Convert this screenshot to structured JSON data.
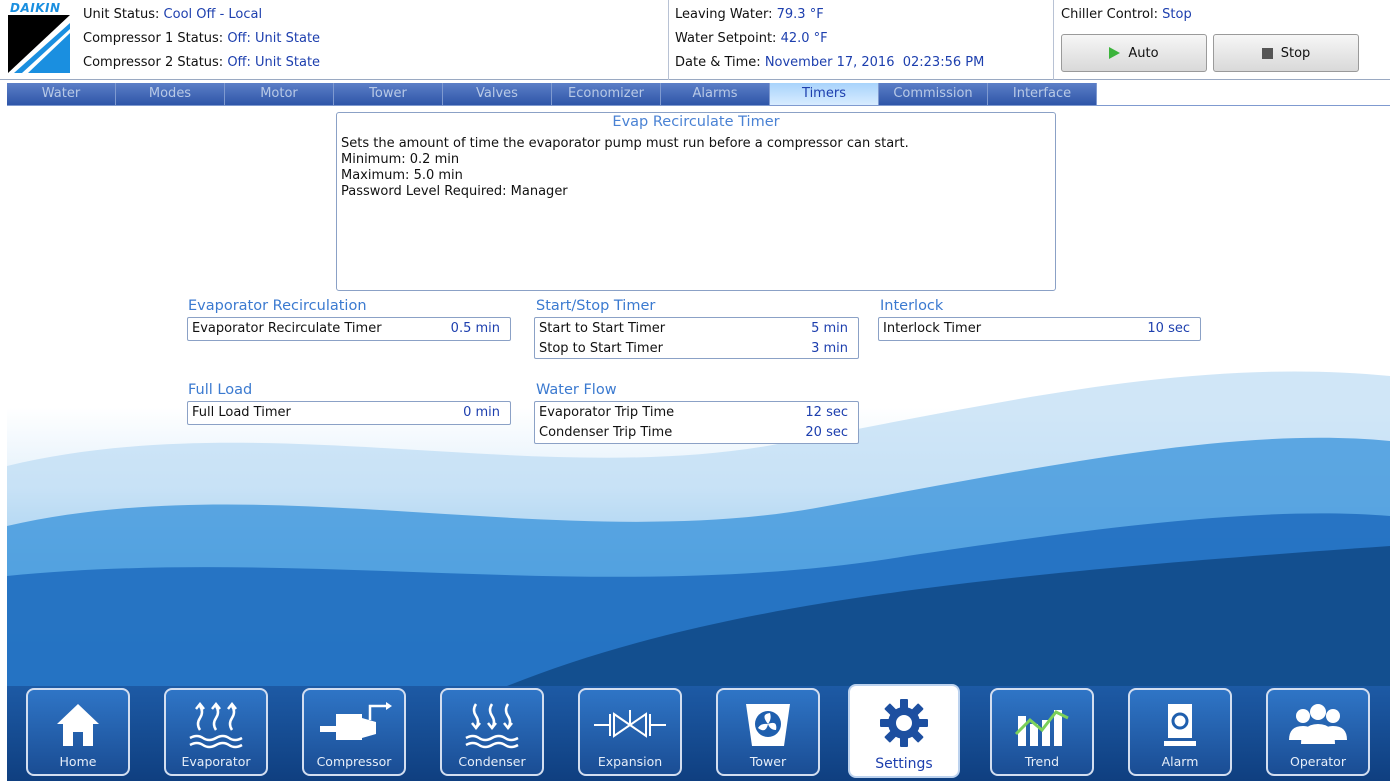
{
  "header": {
    "status_lines": [
      {
        "label": "Unit Status: ",
        "value": "Cool Off - Local"
      },
      {
        "label": "Compressor 1 Status: ",
        "value": "Off: Unit State"
      },
      {
        "label": "Compressor 2 Status: ",
        "value": "Off: Unit State"
      }
    ],
    "readings": [
      {
        "label": "Leaving Water: ",
        "value": "79.3 °F"
      },
      {
        "label": "Water Setpoint: ",
        "value": "42.0 °F"
      },
      {
        "label": "Date & Time: ",
        "value": "November 17, 2016  02:23:56 PM"
      }
    ],
    "chiller_control": {
      "label": "Chiller Control: ",
      "value": "Stop"
    },
    "auto_label": "Auto",
    "stop_label": "Stop",
    "logo_text": "DAIKIN"
  },
  "tabs": [
    "Water",
    "Modes",
    "Motor",
    "Tower",
    "Valves",
    "Economizer",
    "Alarms",
    "Timers",
    "Commission",
    "Interface"
  ],
  "active_tab": "Timers",
  "help": {
    "title": "Evap Recirculate Timer",
    "lines": [
      "Sets the amount of time the evaporator pump must run before a compressor can start.",
      "Minimum: 0.2 min",
      "Maximum: 5.0 min",
      "Password Level Required: Manager"
    ]
  },
  "groups": {
    "evap_recirc": {
      "title": "Evaporator Recirculation",
      "rows": [
        {
          "label": "Evaporator Recirculate Timer",
          "value": "0.5 min"
        }
      ]
    },
    "start_stop": {
      "title": "Start/Stop Timer",
      "rows": [
        {
          "label": "Start to Start Timer",
          "value": "5 min"
        },
        {
          "label": "Stop to Start Timer",
          "value": "3 min"
        }
      ]
    },
    "interlock": {
      "title": "Interlock",
      "rows": [
        {
          "label": "Interlock Timer",
          "value": "10 sec"
        }
      ]
    },
    "full_load": {
      "title": "Full Load",
      "rows": [
        {
          "label": "Full Load Timer",
          "value": "0 min"
        }
      ]
    },
    "water_flow": {
      "title": "Water Flow",
      "rows": [
        {
          "label": "Evaporator Trip Time",
          "value": "12 sec"
        },
        {
          "label": "Condenser Trip Time",
          "value": "20 sec"
        }
      ]
    }
  },
  "nav": [
    {
      "label": "Home",
      "icon": "home-icon"
    },
    {
      "label": "Evaporator",
      "icon": "evaporator-icon"
    },
    {
      "label": "Compressor",
      "icon": "compressor-icon"
    },
    {
      "label": "Condenser",
      "icon": "condenser-icon"
    },
    {
      "label": "Expansion",
      "icon": "expansion-valve-icon"
    },
    {
      "label": "Tower",
      "icon": "tower-fan-icon"
    },
    {
      "label": "Settings",
      "icon": "gear-icon"
    },
    {
      "label": "Trend",
      "icon": "trend-chart-icon"
    },
    {
      "label": "Alarm",
      "icon": "alarm-icon"
    },
    {
      "label": "Operator",
      "icon": "operator-users-icon"
    }
  ],
  "active_nav": "Settings",
  "colors": {
    "accent": "#1d3fae",
    "tab_active": "#a8d3fb",
    "nav_bg": "#1a4d94",
    "play_green": "#3cb43c"
  }
}
